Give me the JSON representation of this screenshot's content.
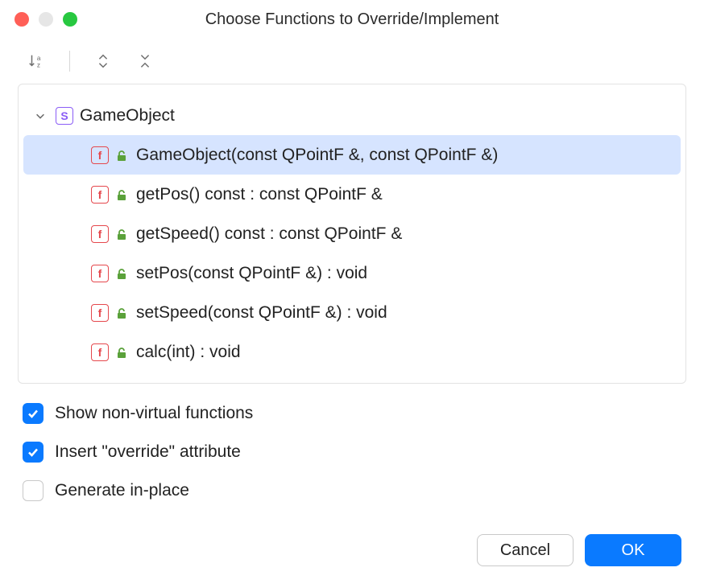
{
  "title": "Choose Functions to Override/Implement",
  "tree": {
    "root": {
      "badge": "S",
      "label": "GameObject"
    },
    "items": [
      {
        "badge": "f",
        "label": "GameObject(const QPointF &, const QPointF &)",
        "selected": true
      },
      {
        "badge": "f",
        "label": "getPos() const : const QPointF &",
        "selected": false
      },
      {
        "badge": "f",
        "label": "getSpeed() const : const QPointF &",
        "selected": false
      },
      {
        "badge": "f",
        "label": "setPos(const QPointF &) : void",
        "selected": false
      },
      {
        "badge": "f",
        "label": "setSpeed(const QPointF &) : void",
        "selected": false
      },
      {
        "badge": "f",
        "label": "calc(int) : void",
        "selected": false
      }
    ]
  },
  "options": {
    "show_non_virtual": {
      "label": "Show non-virtual functions",
      "checked": true
    },
    "insert_override": {
      "label": "Insert \"override\" attribute",
      "checked": true
    },
    "generate_in_place": {
      "label": "Generate in-place",
      "checked": false
    }
  },
  "buttons": {
    "cancel": "Cancel",
    "ok": "OK"
  }
}
